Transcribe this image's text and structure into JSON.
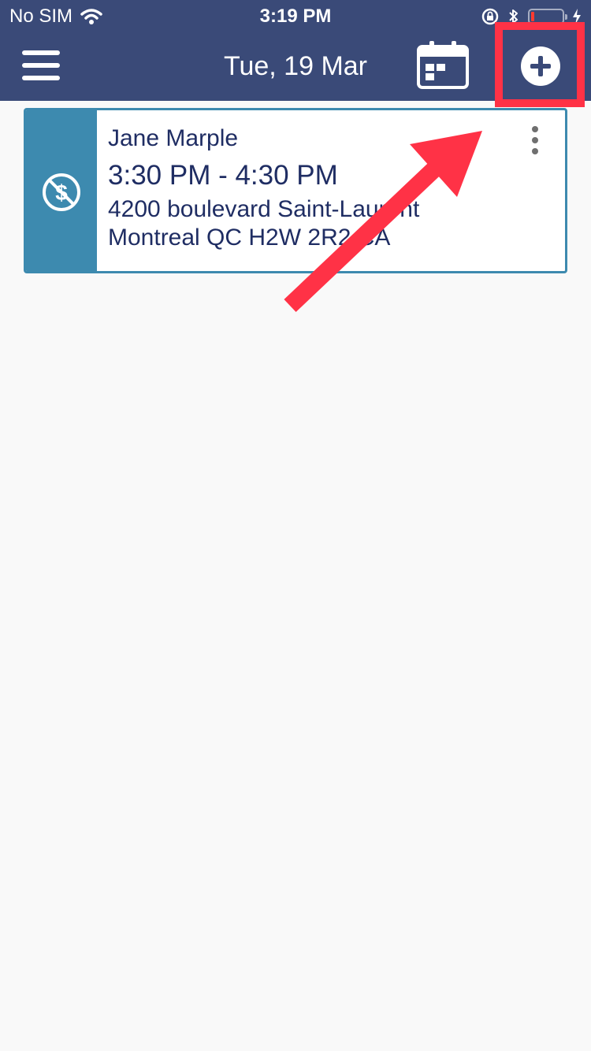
{
  "status_bar": {
    "carrier": "No SIM",
    "time": "3:19 PM"
  },
  "header": {
    "title": "Tue, 19 Mar"
  },
  "appointment": {
    "client_name": "Jane Marple",
    "time_range": "3:30 PM - 4:30 PM",
    "address_line1": "4200 boulevard Saint-Laurent",
    "address_line2": "Montreal QC H2W 2R2 CA"
  },
  "colors": {
    "header_bg": "#3a4a78",
    "card_accent": "#3d8aaf",
    "card_text": "#1f2d63",
    "annotation": "#ff3246",
    "page_bg": "#f9f9f9"
  },
  "icons": {
    "menu": "hamburger-menu-icon",
    "calendar": "calendar-icon",
    "add": "plus-circle-icon",
    "no_payment": "no-dollar-icon",
    "more": "vertical-ellipsis-icon"
  }
}
